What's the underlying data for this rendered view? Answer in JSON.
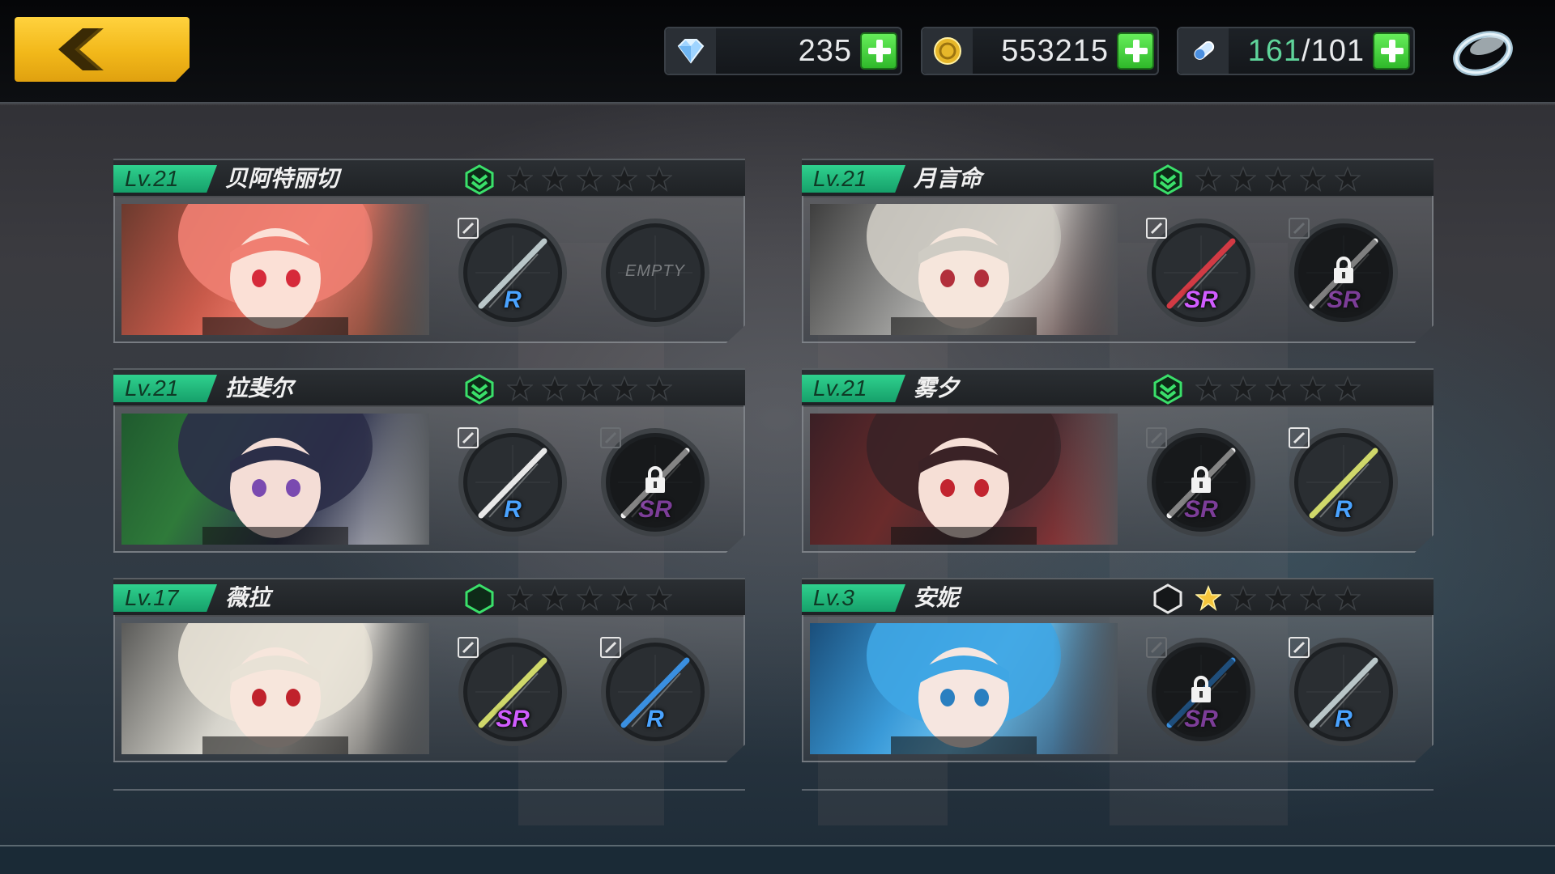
{
  "topbar": {
    "gems": "235",
    "coins": "553215",
    "stamina_current": "161",
    "stamina_sep_max": "/101"
  },
  "icons": {
    "back": "back-chevron-icon",
    "gem": "gem-icon",
    "coin": "coin-icon",
    "stamina": "stamina-vial-icon",
    "plus": "plus-icon",
    "settings": "ring-menu-icon",
    "edit": "edit-pencil-icon",
    "lock": "lock-icon",
    "rank": "rank-chevron-icon",
    "star": "star-icon"
  },
  "colors": {
    "accent_green": "#2fd18e",
    "rarity_r": "#4aa3ff",
    "rarity_sr": "#d05cff",
    "star_gold": "#f5c53b",
    "back_yellow": "#f2b81a"
  },
  "cards": [
    {
      "level": "Lv.21",
      "name": "贝阿特丽切",
      "rank": "chevron",
      "stars_filled": 0,
      "slots": [
        {
          "rarity": "R",
          "state": "equipped",
          "edit": true
        },
        {
          "rarity": "",
          "state": "empty",
          "label": "EMPTY",
          "edit": false
        }
      ]
    },
    {
      "level": "Lv.21",
      "name": "月言命",
      "rank": "chevron",
      "stars_filled": 0,
      "slots": [
        {
          "rarity": "SR",
          "state": "equipped",
          "edit": true
        },
        {
          "rarity": "SR",
          "state": "locked",
          "edit": false
        }
      ]
    },
    {
      "level": "Lv.21",
      "name": "拉斐尔",
      "rank": "chevron",
      "stars_filled": 0,
      "slots": [
        {
          "rarity": "R",
          "state": "equipped",
          "edit": true
        },
        {
          "rarity": "SR",
          "state": "locked",
          "edit": false
        }
      ]
    },
    {
      "level": "Lv.21",
      "name": "雾夕",
      "rank": "chevron",
      "stars_filled": 0,
      "slots": [
        {
          "rarity": "SR",
          "state": "locked",
          "edit": false
        },
        {
          "rarity": "R",
          "state": "equipped",
          "edit": true
        }
      ]
    },
    {
      "level": "Lv.17",
      "name": "薇拉",
      "rank": "hexagon",
      "stars_filled": 0,
      "slots": [
        {
          "rarity": "SR",
          "state": "equipped",
          "edit": true
        },
        {
          "rarity": "R",
          "state": "equipped",
          "edit": true
        }
      ]
    },
    {
      "level": "Lv.3",
      "name": "安妮",
      "rank": "hexagon-outline",
      "stars_filled": 1,
      "slots": [
        {
          "rarity": "SR",
          "state": "locked",
          "edit": false
        },
        {
          "rarity": "R",
          "state": "equipped",
          "edit": true
        }
      ]
    }
  ]
}
